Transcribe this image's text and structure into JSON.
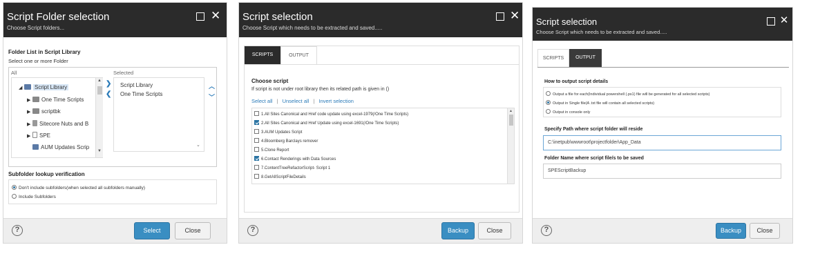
{
  "dialog1": {
    "title": "Script Folder selection",
    "subtitle": "Choose Script folders...",
    "folder_list_heading": "Folder List in Script Library",
    "folder_list_sub": "Select one or more Folder",
    "all_label": "All",
    "selected_label": "Selected",
    "tree": [
      {
        "label": "Script Library",
        "icon": "library-icon"
      },
      {
        "label": "One Time Scripts",
        "icon": "folder-icon"
      },
      {
        "label": "scriptbk",
        "icon": "folder-icon"
      },
      {
        "label": "Sitecore Nuts and B",
        "icon": "module-icon"
      },
      {
        "label": "SPE",
        "icon": "folder-icon"
      },
      {
        "label": "AUM Updates Scrip",
        "icon": "script-icon"
      }
    ],
    "selected_items": [
      "Script Library",
      "One Time Scripts"
    ],
    "subfolder_heading": "Subfolder lookup verification",
    "subfolder_options": [
      {
        "label": "Don't include subfolders(when selected all subfolders manually)",
        "checked": true
      },
      {
        "label": "Include Subfolders",
        "checked": false
      }
    ],
    "buttons": {
      "primary": "Select",
      "secondary": "Close"
    }
  },
  "dialog2": {
    "title": "Script selection",
    "subtitle": "Choose Script which needs to be extracted and saved.....",
    "tabs": [
      "SCRIPTS",
      "OUTPUT"
    ],
    "choose_heading": "Choose script",
    "choose_sub": "If script is not under root library then its related path is given in ()",
    "links": [
      "Select all",
      "Unselect all",
      "Invert selection"
    ],
    "separator": "|",
    "scripts": [
      {
        "label": "1.All Sites Canonical and Href code update using excel-1979(/One Time Scripts)",
        "checked": false
      },
      {
        "label": "2.All Sites Canonical and Href Update using excel-1691(/One Time Scripts)",
        "checked": true
      },
      {
        "label": "3.AUM Updates Script",
        "checked": false
      },
      {
        "label": "4.Bloomberg Barclays remover",
        "checked": false
      },
      {
        "label": "5.Clone Report",
        "checked": false
      },
      {
        "label": "6.Contact Renderings with Data Sources",
        "checked": true
      },
      {
        "label": "7.ContentTreeRefactorScript- Script 1",
        "checked": false
      },
      {
        "label": "8.GetAllScriptFileDetails",
        "checked": false
      }
    ],
    "buttons": {
      "primary": "Backup",
      "secondary": "Close"
    }
  },
  "dialog3": {
    "title": "Script selection",
    "subtitle": "Choose Script which needs to be extracted and saved.....",
    "tabs": [
      "SCRIPTS",
      "OUTPUT"
    ],
    "output_heading": "How to output script details",
    "output_options": [
      {
        "label": "Output a file for each(Individual powershell (.ps1) file will be generated for all selected scripts)",
        "checked": false
      },
      {
        "label": "Output in Single file(A .txt file will contain all selected scripts)",
        "checked": true
      },
      {
        "label": "Output in console only",
        "checked": false
      }
    ],
    "path_heading": "Specify Path where script folder will reside",
    "path_value": "C:\\inetpub\\wwwroot\\projectfolder\\App_Data",
    "name_heading": "Folder Name where script file/s to be saved",
    "name_value": "SPEScriptBackup",
    "buttons": {
      "primary": "Backup",
      "secondary": "Close"
    }
  },
  "colors": {
    "titlebar": "#2b2b2b",
    "primary": "#3a8ec2",
    "link": "#2a7ab8"
  }
}
